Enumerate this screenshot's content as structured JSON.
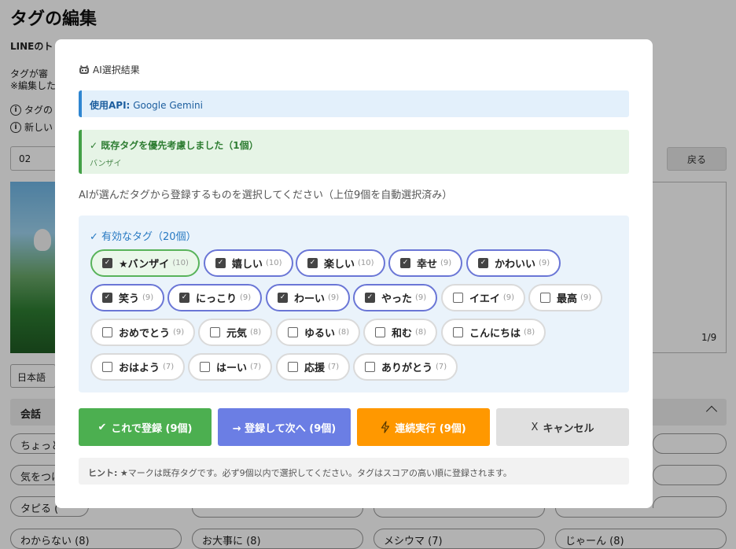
{
  "page": {
    "title": "タグの編集",
    "subtitle": "LINEのト",
    "desc_line1": "タグが審",
    "desc_line2": "※編集した",
    "info1": "タグの",
    "info2": "新しい",
    "input_value": "02",
    "back_label": "戻る",
    "counter": "1/9",
    "language": "日本語",
    "section_label": "会話",
    "pills": [
      "ちょっと",
      "気をつけ",
      "タピる (",
      "わからない (8)",
      "お大事に (8)",
      "メシウマ (7)",
      "じゃーん (8)"
    ]
  },
  "modal": {
    "header": "AI選択結果",
    "api_label": "使用API:",
    "api_value": "Google Gemini",
    "existing_title": "✓ 既存タグを優先考慮しました（1個）",
    "existing_tags": "バンザイ",
    "instruction": "AIが選んだタグから登録するものを選択してください（上位9個を自動選択済み）",
    "valid_title": "✓ 有効なタグ（20個）",
    "tags": [
      {
        "name": "★バンザイ",
        "count": "(10)",
        "checked": true,
        "existing": true
      },
      {
        "name": "嬉しい",
        "count": "(10)",
        "checked": true,
        "existing": false
      },
      {
        "name": "楽しい",
        "count": "(10)",
        "checked": true,
        "existing": false
      },
      {
        "name": "幸せ",
        "count": "(9)",
        "checked": true,
        "existing": false
      },
      {
        "name": "かわいい",
        "count": "(9)",
        "checked": true,
        "existing": false
      },
      {
        "name": "笑う",
        "count": "(9)",
        "checked": true,
        "existing": false
      },
      {
        "name": "にっこり",
        "count": "(9)",
        "checked": true,
        "existing": false
      },
      {
        "name": "わーい",
        "count": "(9)",
        "checked": true,
        "existing": false
      },
      {
        "name": "やった",
        "count": "(9)",
        "checked": true,
        "existing": false
      },
      {
        "name": "イエイ",
        "count": "(9)",
        "checked": false,
        "existing": false
      },
      {
        "name": "最高",
        "count": "(9)",
        "checked": false,
        "existing": false
      },
      {
        "name": "おめでとう",
        "count": "(9)",
        "checked": false,
        "existing": false
      },
      {
        "name": "元気",
        "count": "(8)",
        "checked": false,
        "existing": false
      },
      {
        "name": "ゆるい",
        "count": "(8)",
        "checked": false,
        "existing": false
      },
      {
        "name": "和む",
        "count": "(8)",
        "checked": false,
        "existing": false
      },
      {
        "name": "こんにちは",
        "count": "(8)",
        "checked": false,
        "existing": false
      },
      {
        "name": "おはよう",
        "count": "(7)",
        "checked": false,
        "existing": false
      },
      {
        "name": "はーい",
        "count": "(7)",
        "checked": false,
        "existing": false
      },
      {
        "name": "応援",
        "count": "(7)",
        "checked": false,
        "existing": false
      },
      {
        "name": "ありがとう",
        "count": "(7)",
        "checked": false,
        "existing": false
      }
    ],
    "buttons": {
      "register": "これで登録 (9個)",
      "register_next": "→ 登録して次へ (9個)",
      "batch": "連続実行 (9個)",
      "cancel": "キャンセル"
    },
    "hint_label": "ヒント:",
    "hint_text": "★マークは既存タグです。必ず9個以内で選択してください。タグはスコアの高い順に登録されます。"
  },
  "colors": {
    "accent_blue": "#2f86d1",
    "existing_green": "#43a047",
    "selected_border": "#6a76d6",
    "btn_green": "#4caf50",
    "btn_blue": "#6b7ee4",
    "btn_orange": "#ff9800",
    "btn_grey": "#e0e0e0"
  },
  "icons": {
    "header": "robot-icon",
    "info": "info-icon",
    "register": "check-icon",
    "batch": "lightning-icon",
    "cancel": "close-icon",
    "section": "chevron-up-icon"
  }
}
